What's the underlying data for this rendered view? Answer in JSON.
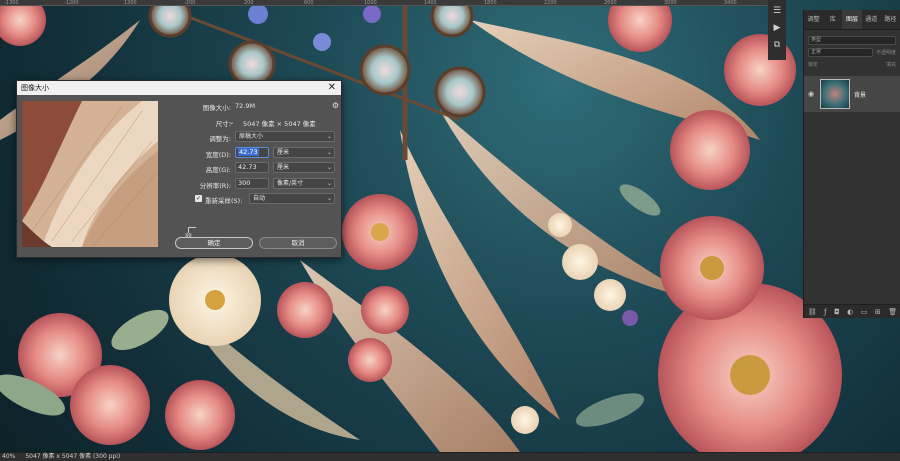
{
  "ruler": {
    "ticks": [
      "-1300",
      "-1200",
      "1300",
      "-200",
      "200",
      "600",
      "1000",
      "1400",
      "1800",
      "2200",
      "2600",
      "3000",
      "3400",
      "3800",
      "4200",
      "4600"
    ]
  },
  "toolstrip": {
    "icons": [
      "menu-icon",
      "play-icon",
      "arrange-icon"
    ]
  },
  "layers_panel": {
    "tabs": [
      "调整",
      "库",
      "图层",
      "通道",
      "路径"
    ],
    "active_tab": "图层",
    "kind_label": "类型",
    "mode_label": "正常",
    "opacity_label": "不透明度",
    "lock_label": "锁定",
    "fill_label": "填充",
    "layer_name": "背景",
    "footer_icons": [
      "link-icon",
      "fx-icon",
      "mask-icon",
      "adjustment-icon",
      "group-icon",
      "new-layer-icon",
      "trash-icon"
    ]
  },
  "status": {
    "zoom": "40%",
    "doc_info": "5047 像素 x 5047 像素 (300 ppi)"
  },
  "dialog": {
    "title": "图像大小",
    "image_size_label": "图像大小:",
    "image_size_value": "72.9M",
    "dimensions_label": "尺寸:",
    "dimensions_value": "5047 像素 × 5047 像素",
    "fit_label": "调整为:",
    "fit_value": "原稿大小",
    "width_label": "宽度(D):",
    "width_value": "42.73",
    "width_unit": "厘米",
    "height_label": "高度(G):",
    "height_value": "42.73",
    "height_unit": "厘米",
    "resolution_label": "分辨率(R):",
    "resolution_value": "300",
    "resolution_unit": "像素/英寸",
    "resample_label": "重新采样(S):",
    "resample_value": "自动",
    "resample_checked": true,
    "ok_label": "确定",
    "cancel_label": "取消"
  },
  "colors": {
    "dialog_bg": "#535353",
    "panel_bg": "#323232",
    "focus": "#3b6ccf"
  }
}
